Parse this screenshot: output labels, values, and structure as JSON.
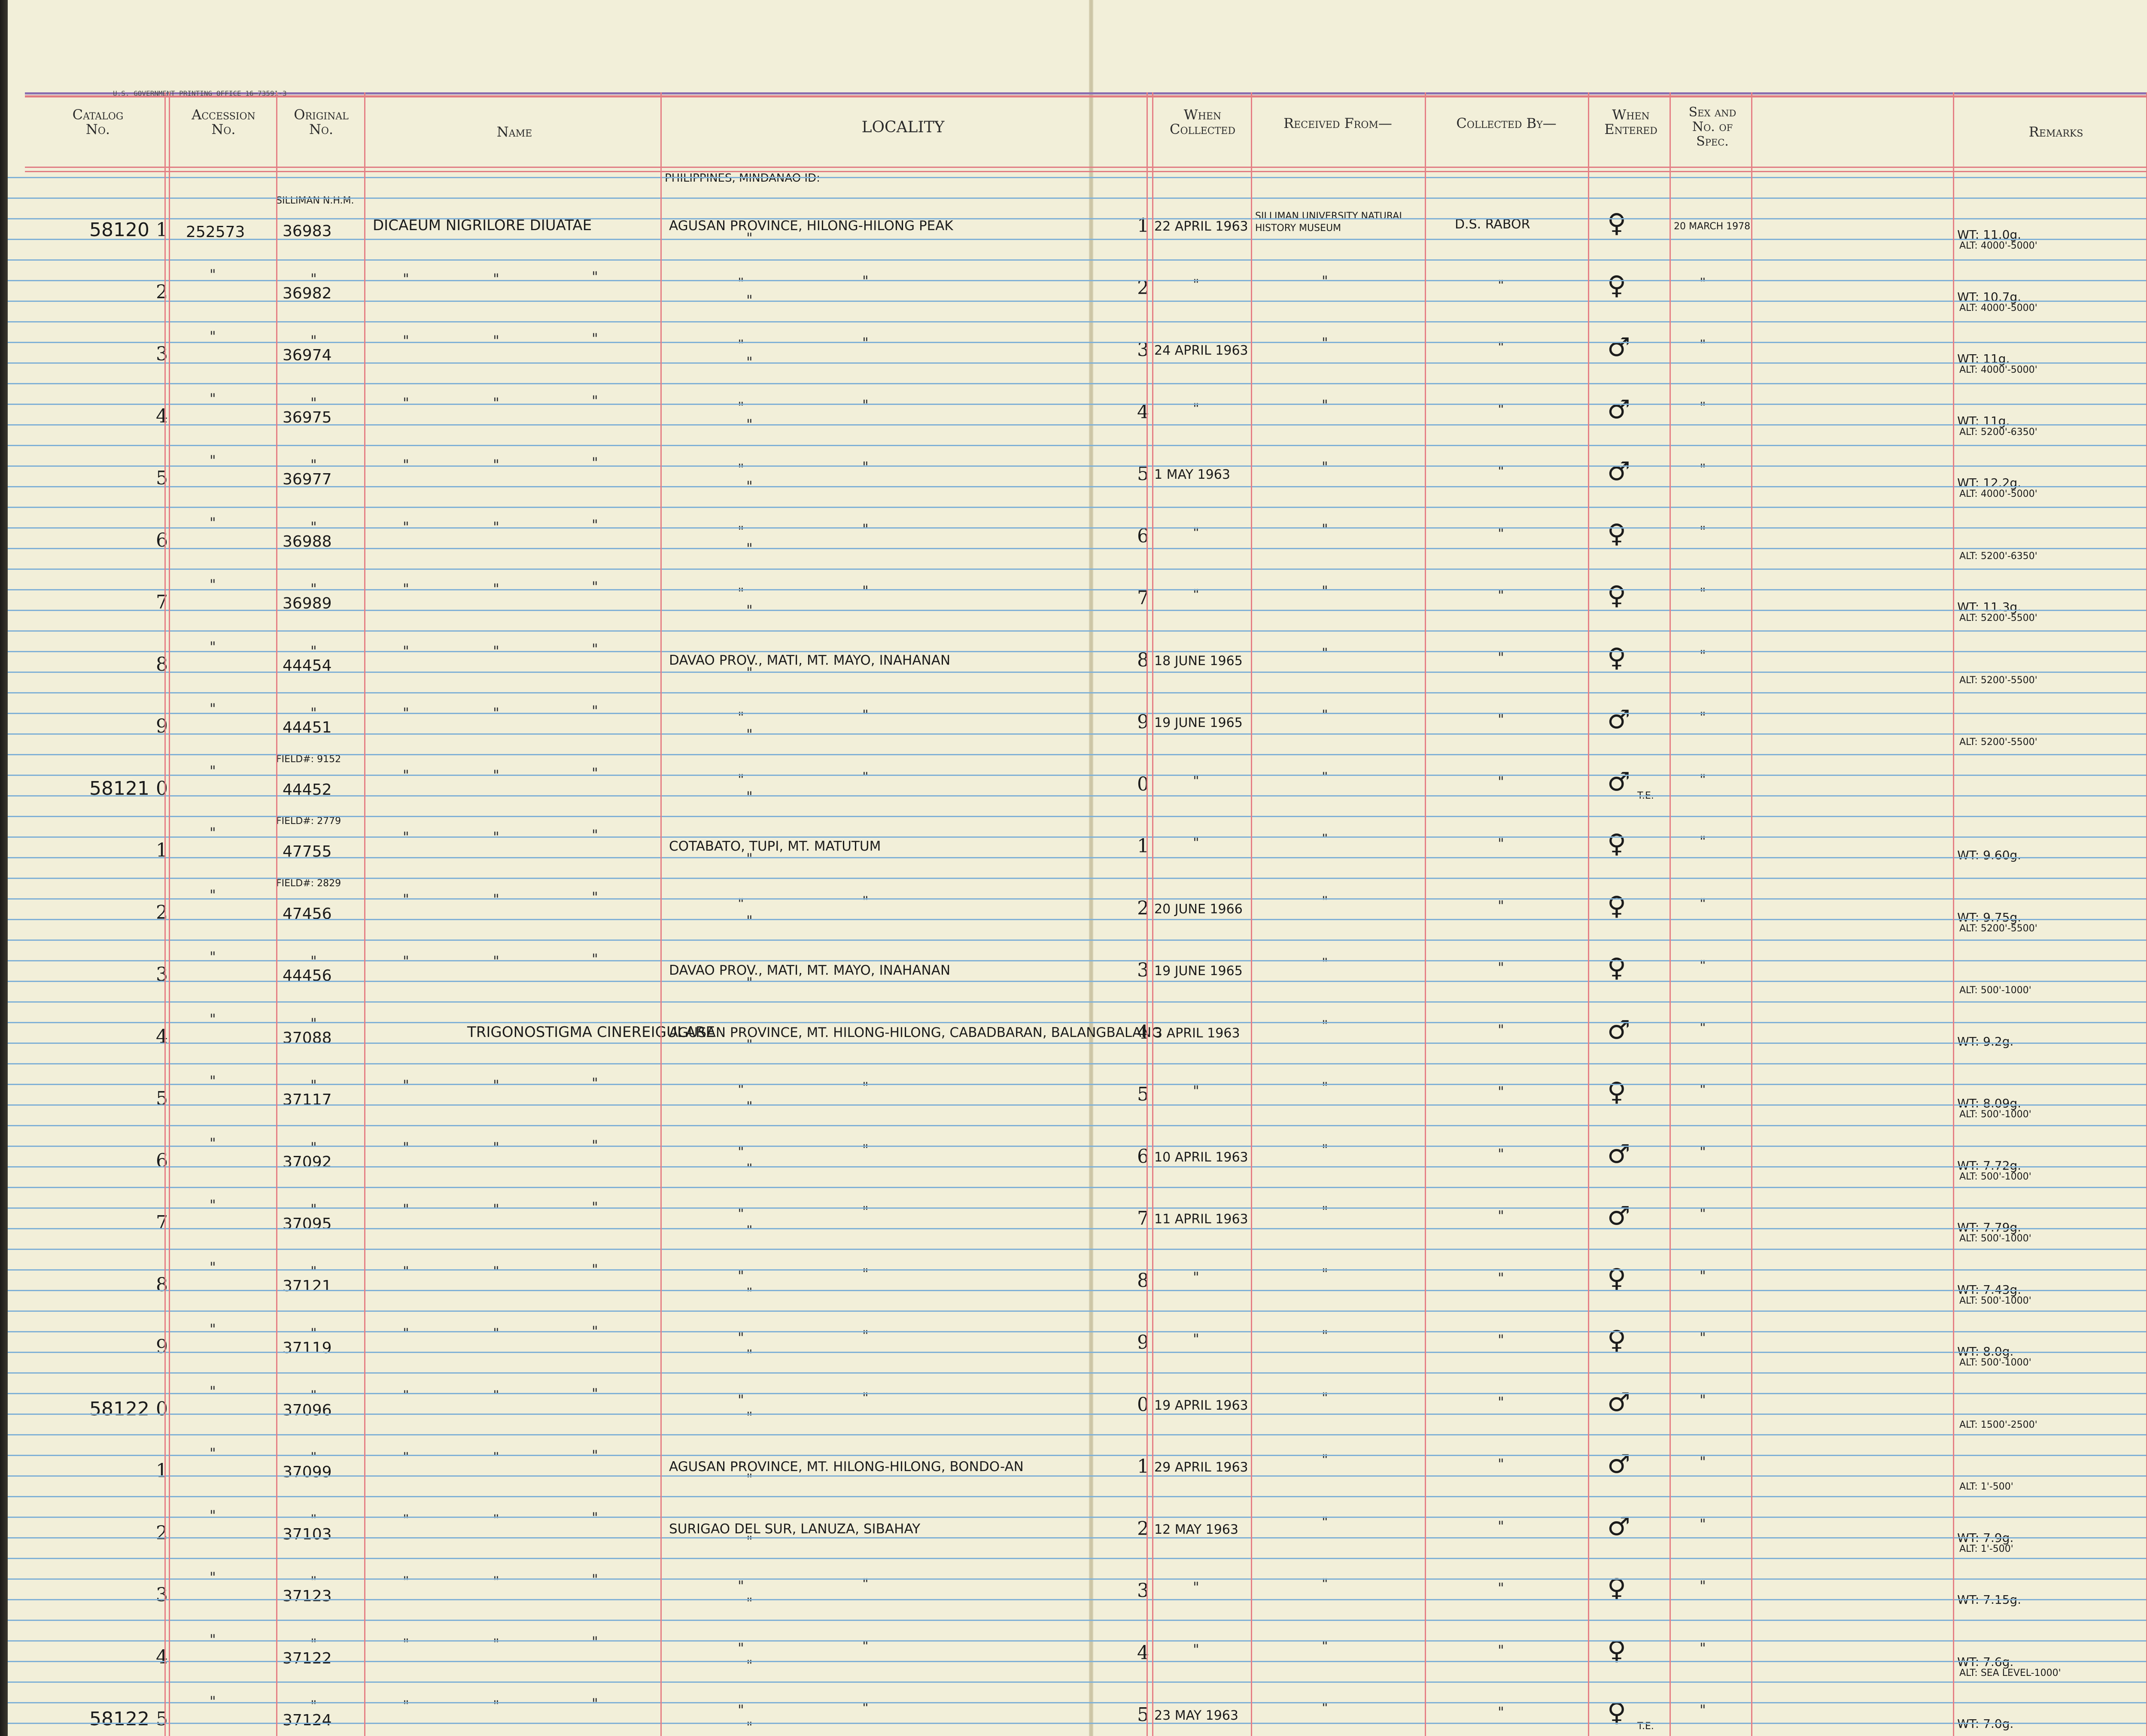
{
  "print_note": "U.S. GOVERNMENT PRINTING OFFICE   16—73591-3",
  "headers": {
    "catalog": "Catalog\nNo.",
    "accession": "Accession\nNo.",
    "original": "Original\nNo.",
    "name": "Name",
    "locality": "LOCALITY",
    "when_collected": "When\nCollected",
    "received_from": "Received From—",
    "collected_by": "Collected By—",
    "when_entered": "When\nEntered",
    "sex": "Sex and\nNo. of\nSpec.",
    "remarks": "Remarks"
  },
  "locality_note": "PHILIPPINES, MINDANAO ID:",
  "ditto": "\"",
  "rows": [
    {
      "num": "1",
      "catalog": "58120",
      "accession": "252573",
      "orig_top": "SILLIMAN N.H.M.",
      "orig": "36983",
      "name": "DICAEUM NIGRILORE DIUATAE",
      "locality": "AGUSAN PROVINCE, HILONG-HILONG PEAK",
      "date": "22 APRIL 1963",
      "received": "SILLIMAN UNIVERSITY NATURAL HISTORY MUSEUM",
      "collector": "D.S. RABOR",
      "sex": "♀",
      "entered": "20 MARCH 1978",
      "rem_alt": "ALT: 4000'-5000'",
      "rem_wt": "WT: 11.0g."
    },
    {
      "num": "2",
      "orig": "36982",
      "sex": "♀",
      "rem_alt": "ALT: 4000'-5000'",
      "rem_wt": "WT: 10.7g."
    },
    {
      "num": "3",
      "orig": "36974",
      "date": "24 APRIL 1963",
      "sex": "♂",
      "rem_alt": "ALT: 4000'-5000'",
      "rem_wt": "WT: 11g."
    },
    {
      "num": "4",
      "orig": "36975",
      "sex": "♂",
      "rem_alt": "ALT: 5200'-6350'",
      "rem_wt": "WT: 11g."
    },
    {
      "num": "5",
      "orig": "36977",
      "date": "1 MAY 1963",
      "sex": "♂",
      "rem_alt": "ALT: 4000'-5000'",
      "rem_wt": "WT: 12.2g."
    },
    {
      "num": "6",
      "orig": "36988",
      "sex": "♀",
      "rem_alt": "ALT: 5200'-6350'"
    },
    {
      "num": "7",
      "orig": "36989",
      "sex": "♀",
      "rem_alt": "ALT: 5200'-5500'",
      "rem_wt": "WT: 11.3g."
    },
    {
      "num": "8",
      "orig": "44454",
      "locality": "DAVAO PROV., MATI, MT. MAYO, INAHANAN",
      "date": "18 JUNE 1965",
      "sex": "♀",
      "rem_alt": "ALT: 5200'-5500'"
    },
    {
      "num": "9",
      "orig": "44451",
      "date": "19 JUNE 1965",
      "sex": "♂",
      "rem_alt": "ALT: 5200'-5500'"
    },
    {
      "num": "0",
      "catalog": "58121",
      "orig_top": "FIELD#: 9152",
      "orig": "44452",
      "sex": "♂",
      "sex_note": "T.E."
    },
    {
      "num": "1",
      "orig_top": "FIELD#: 2779",
      "orig": "47755",
      "locality": "COTABATO, TUPI, MT. MATUTUM",
      "sex": "♀",
      "rem_wt": "WT: 9.60g."
    },
    {
      "num": "2",
      "orig_top": "FIELD#: 2829",
      "orig": "47456",
      "date": "20 JUNE 1966",
      "sex": "♀",
      "rem_alt": "ALT: 5200'-5500'",
      "rem_wt": "WT: 9.75g."
    },
    {
      "num": "3",
      "orig": "44456",
      "locality": "DAVAO PROV., MATI, MT. MAYO, INAHANAN",
      "date": "19 JUNE 1965",
      "sex": "♀",
      "rem_alt": "ALT: 500'-1000'"
    },
    {
      "num": "4",
      "orig": "37088",
      "name": "TRIGONOSTIGMA CINEREIGULARE",
      "locality": "AGUSAN PROVINCE, MT. HILONG-HILONG, CABADBARAN, BALANGBALANG",
      "date": "3 APRIL 1963",
      "sex": "♂",
      "rem_wt": "WT: 9.2g."
    },
    {
      "num": "5",
      "orig": "37117",
      "sex": "♀",
      "rem_alt": "ALT: 500'-1000'",
      "rem_wt": "WT: 8.09g."
    },
    {
      "num": "6",
      "orig": "37092",
      "date": "10 APRIL 1963",
      "sex": "♂",
      "rem_alt": "ALT: 500'-1000'",
      "rem_wt": "WT: 7.72g."
    },
    {
      "num": "7",
      "orig": "37095",
      "date": "11 APRIL 1963",
      "sex": "♂",
      "rem_alt": "ALT: 500'-1000'",
      "rem_wt": "WT: 7.79g."
    },
    {
      "num": "8",
      "orig": "37121",
      "sex": "♀",
      "rem_alt": "ALT: 500'-1000'",
      "rem_wt": "WT: 7.43g."
    },
    {
      "num": "9",
      "orig": "37119",
      "sex": "♀",
      "rem_alt": "ALT: 500'-1000'",
      "rem_wt": "WT: 8.0g."
    },
    {
      "num": "0",
      "catalog": "58122",
      "orig": "37096",
      "date": "19 APRIL 1963",
      "sex": "♂",
      "rem_alt": "ALT: 1500'-2500'"
    },
    {
      "num": "1",
      "orig": "37099",
      "locality": "AGUSAN PROVINCE, MT. HILONG-HILONG, BONDO-AN",
      "date": "29 APRIL 1963",
      "sex": "♂",
      "rem_alt": "ALT: 1'-500'"
    },
    {
      "num": "2",
      "orig": "37103",
      "locality": "SURIGAO DEL SUR, LANUZA, SIBAHAY",
      "date": "12 MAY 1963",
      "sex": "♂",
      "rem_alt": "ALT: 1'-500'",
      "rem_wt": "WT: 7.9g."
    },
    {
      "num": "3",
      "orig": "37123",
      "sex": "♀",
      "rem_wt": "WT: 7.15g."
    },
    {
      "num": "4",
      "orig": "37122",
      "sex": "♀",
      "rem_alt": "ALT: SEA LEVEL-1000'",
      "rem_wt": "WT: 7.6g."
    },
    {
      "num": "5",
      "catalog": "58122",
      "orig": "37124",
      "date": "23 MAY 1963",
      "sex": "♀",
      "sex_note": "T.E.",
      "rem_wt": "WT: 7.0g."
    }
  ]
}
